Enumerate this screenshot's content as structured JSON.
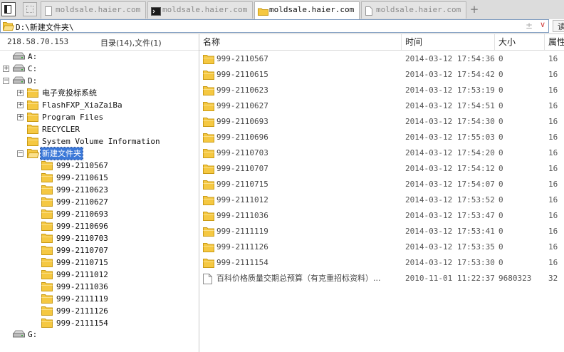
{
  "tabs": [
    {
      "label": "moldsale.haier.com",
      "icon": "page-icon",
      "active": false
    },
    {
      "label": "moldsale.haier.com",
      "icon": "terminal-icon",
      "active": false
    },
    {
      "label": "moldsale.haier.com",
      "icon": "folder-icon",
      "active": true
    },
    {
      "label": "moldsale.haier.com",
      "icon": "document-icon",
      "active": false
    }
  ],
  "tab_add_label": "+",
  "address": {
    "path": "D:\\新建文件夹\\",
    "clear_glyph": "±",
    "dropdown_glyph": "∨",
    "extra_label": "读"
  },
  "left": {
    "ip": "218.58.70.153",
    "counts": "目录(14),文件(1)",
    "tree": [
      {
        "label": "A:",
        "icon": "drive-icon",
        "toggle": ""
      },
      {
        "label": "C:",
        "icon": "drive-icon",
        "toggle": "+"
      },
      {
        "label": "D:",
        "icon": "drive-icon",
        "toggle": "−"
      },
      {
        "label": "电子竞投标系统",
        "icon": "folder-icon",
        "toggle": "+"
      },
      {
        "label": "FlashFXP_XiaZaiBa",
        "icon": "folder-icon",
        "toggle": "+"
      },
      {
        "label": "Program Files",
        "icon": "folder-icon",
        "toggle": "+"
      },
      {
        "label": "RECYCLER",
        "icon": "folder-icon",
        "toggle": ""
      },
      {
        "label": "System Volume Information",
        "icon": "folder-icon",
        "toggle": ""
      },
      {
        "label": "新建文件夹",
        "icon": "folder-open-icon",
        "toggle": "−",
        "selected": true
      },
      {
        "label": "999-2110567",
        "icon": "folder-icon",
        "toggle": ""
      },
      {
        "label": "999-2110615",
        "icon": "folder-icon",
        "toggle": ""
      },
      {
        "label": "999-2110623",
        "icon": "folder-icon",
        "toggle": ""
      },
      {
        "label": "999-2110627",
        "icon": "folder-icon",
        "toggle": ""
      },
      {
        "label": "999-2110693",
        "icon": "folder-icon",
        "toggle": ""
      },
      {
        "label": "999-2110696",
        "icon": "folder-icon",
        "toggle": ""
      },
      {
        "label": "999-2110703",
        "icon": "folder-icon",
        "toggle": ""
      },
      {
        "label": "999-2110707",
        "icon": "folder-icon",
        "toggle": ""
      },
      {
        "label": "999-2110715",
        "icon": "folder-icon",
        "toggle": ""
      },
      {
        "label": "999-2111012",
        "icon": "folder-icon",
        "toggle": ""
      },
      {
        "label": "999-2111036",
        "icon": "folder-icon",
        "toggle": ""
      },
      {
        "label": "999-2111119",
        "icon": "folder-icon",
        "toggle": ""
      },
      {
        "label": "999-2111126",
        "icon": "folder-icon",
        "toggle": ""
      },
      {
        "label": "999-2111154",
        "icon": "folder-icon",
        "toggle": ""
      },
      {
        "label": "G:",
        "icon": "drive-icon",
        "toggle": ""
      }
    ]
  },
  "right": {
    "columns": {
      "name": "名称",
      "time": "时间",
      "size": "大小",
      "attr": "属性"
    },
    "rows": [
      {
        "name": "999-2110567",
        "time": "2014-03-12 17:54:36",
        "size": "0",
        "attr": "16",
        "icon": "folder-icon"
      },
      {
        "name": "999-2110615",
        "time": "2014-03-12 17:54:42",
        "size": "0",
        "attr": "16",
        "icon": "folder-icon"
      },
      {
        "name": "999-2110623",
        "time": "2014-03-12 17:53:19",
        "size": "0",
        "attr": "16",
        "icon": "folder-icon"
      },
      {
        "name": "999-2110627",
        "time": "2014-03-12 17:54:51",
        "size": "0",
        "attr": "16",
        "icon": "folder-icon"
      },
      {
        "name": "999-2110693",
        "time": "2014-03-12 17:54:30",
        "size": "0",
        "attr": "16",
        "icon": "folder-icon"
      },
      {
        "name": "999-2110696",
        "time": "2014-03-12 17:55:03",
        "size": "0",
        "attr": "16",
        "icon": "folder-icon"
      },
      {
        "name": "999-2110703",
        "time": "2014-03-12 17:54:20",
        "size": "0",
        "attr": "16",
        "icon": "folder-icon"
      },
      {
        "name": "999-2110707",
        "time": "2014-03-12 17:54:12",
        "size": "0",
        "attr": "16",
        "icon": "folder-icon"
      },
      {
        "name": "999-2110715",
        "time": "2014-03-12 17:54:07",
        "size": "0",
        "attr": "16",
        "icon": "folder-icon"
      },
      {
        "name": "999-2111012",
        "time": "2014-03-12 17:53:52",
        "size": "0",
        "attr": "16",
        "icon": "folder-icon"
      },
      {
        "name": "999-2111036",
        "time": "2014-03-12 17:53:47",
        "size": "0",
        "attr": "16",
        "icon": "folder-icon"
      },
      {
        "name": "999-2111119",
        "time": "2014-03-12 17:53:41",
        "size": "0",
        "attr": "16",
        "icon": "folder-icon"
      },
      {
        "name": "999-2111126",
        "time": "2014-03-12 17:53:35",
        "size": "0",
        "attr": "16",
        "icon": "folder-icon"
      },
      {
        "name": "999-2111154",
        "time": "2014-03-12 17:53:30",
        "size": "0",
        "attr": "16",
        "icon": "folder-icon"
      },
      {
        "name": "百科价格质量交期总预算（有克重招标资料）...",
        "time": "2010-11-01 11:22:37",
        "size": "9680323",
        "attr": "32",
        "icon": "file-icon"
      }
    ]
  },
  "colors": {
    "folder": "#f5c842",
    "folder_dark": "#c99a14",
    "selection": "#3b78d8"
  }
}
